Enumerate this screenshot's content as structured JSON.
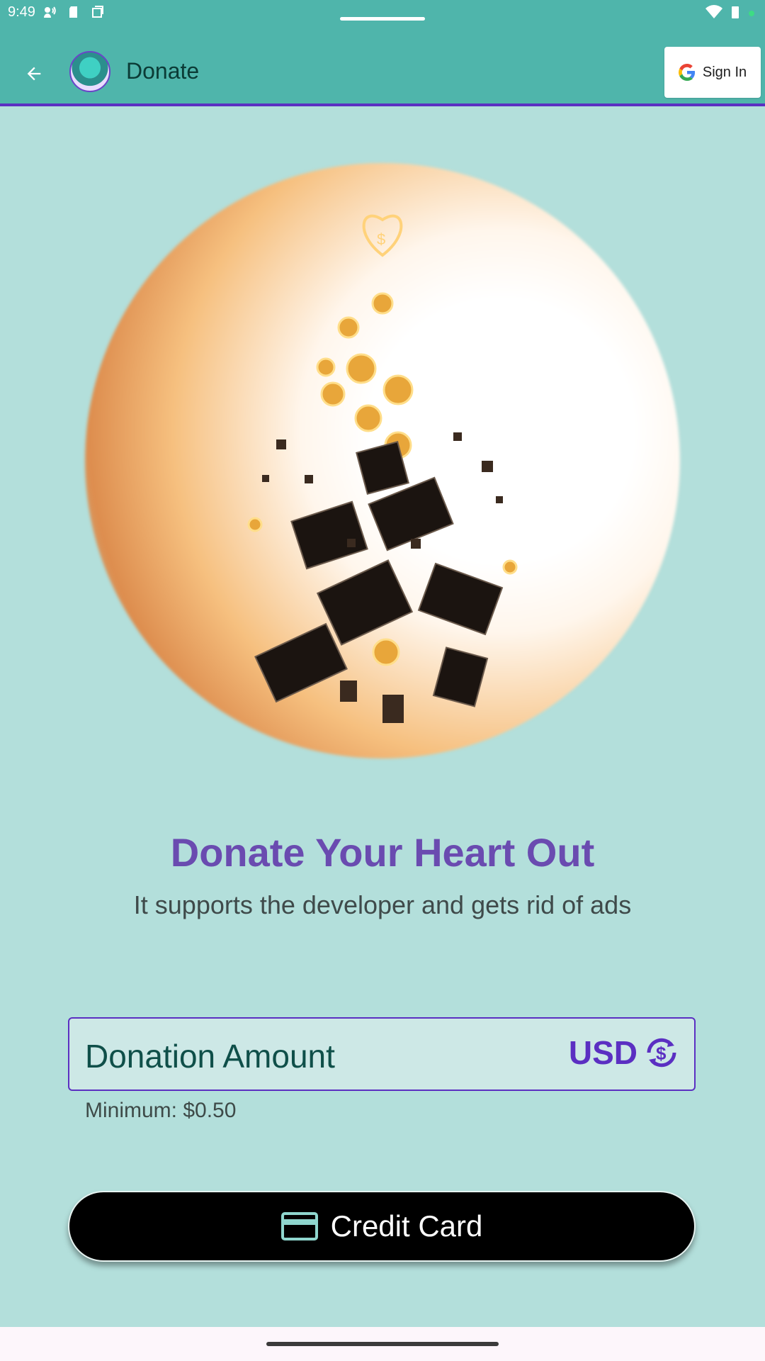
{
  "status_bar": {
    "time": "9:49"
  },
  "app_bar": {
    "title": "Donate",
    "signin_label": "Sign In"
  },
  "hero": {
    "headline": "Donate Your Heart Out",
    "subtitle": "It supports the developer and gets rid of ads"
  },
  "donation": {
    "placeholder": "Donation Amount",
    "currency": "USD",
    "minimum_label": "Minimum: $0.50"
  },
  "actions": {
    "credit_card_label": "Credit Card"
  },
  "colors": {
    "app_bar": "#4fb5ab",
    "background": "#b3dfdb",
    "accent": "#5b2fc2",
    "headline": "#6a4bb0"
  }
}
